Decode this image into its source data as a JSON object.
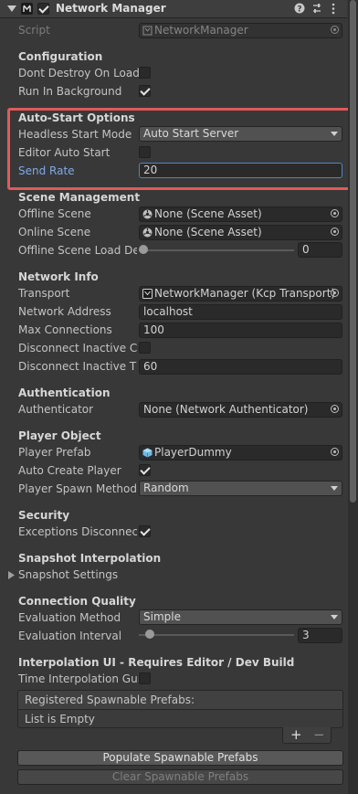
{
  "header": {
    "title": "Network Manager"
  },
  "script": {
    "label": "Script",
    "value": "NetworkManager"
  },
  "configuration": {
    "title": "Configuration",
    "dont_destroy": {
      "label": "Dont Destroy On Load",
      "checked": false
    },
    "run_background": {
      "label": "Run In Background",
      "checked": true
    }
  },
  "auto_start": {
    "title": "Auto-Start Options",
    "headless_mode": {
      "label": "Headless Start Mode",
      "value": "Auto Start Server"
    },
    "editor_auto_start": {
      "label": "Editor Auto Start",
      "checked": false
    },
    "send_rate": {
      "label": "Send Rate",
      "value": "20"
    }
  },
  "scene_management": {
    "title": "Scene Management",
    "offline_scene": {
      "label": "Offline Scene",
      "value": "None (Scene Asset)"
    },
    "online_scene": {
      "label": "Online Scene",
      "value": "None (Scene Asset)"
    },
    "offline_delay": {
      "label": "Offline Scene Load Del",
      "value": "0",
      "level": 0
    }
  },
  "network_info": {
    "title": "Network Info",
    "transport": {
      "label": "Transport",
      "value": "NetworkManager (Kcp Transport)"
    },
    "address": {
      "label": "Network Address",
      "value": "localhost"
    },
    "max_connections": {
      "label": "Max Connections",
      "value": "100"
    },
    "disconnect_inactive": {
      "label": "Disconnect Inactive Co",
      "checked": false
    },
    "disconnect_timeout": {
      "label": "Disconnect Inactive Tir",
      "value": "60"
    }
  },
  "authentication": {
    "title": "Authentication",
    "authenticator": {
      "label": "Authenticator",
      "value": "None (Network Authenticator)"
    }
  },
  "player_object": {
    "title": "Player Object",
    "prefab": {
      "label": "Player Prefab",
      "value": "PlayerDummy"
    },
    "auto_create": {
      "label": "Auto Create Player",
      "checked": true
    },
    "spawn_method": {
      "label": "Player Spawn Method",
      "value": "Random"
    }
  },
  "security": {
    "title": "Security",
    "exceptions": {
      "label": "Exceptions Disconnect",
      "checked": true
    }
  },
  "snapshot": {
    "title": "Snapshot Interpolation",
    "settings": {
      "label": "Snapshot Settings"
    }
  },
  "connection_quality": {
    "title": "Connection Quality",
    "method": {
      "label": "Evaluation Method",
      "value": "Simple"
    },
    "interval": {
      "label": "Evaluation Interval",
      "value": "3"
    }
  },
  "interp_ui": {
    "title": "Interpolation UI - Requires Editor / Dev Build",
    "time_gui": {
      "label": "Time Interpolation Gui",
      "checked": false
    }
  },
  "spawnables": {
    "header": "Registered Spawnable Prefabs:",
    "empty": "List is Empty",
    "add": "+",
    "remove": "−"
  },
  "buttons": {
    "populate": "Populate Spawnable Prefabs",
    "clear": "Clear Spawnable Prefabs"
  },
  "colors": {
    "highlight": "#e15a5a",
    "active_label": "#7fa9e8",
    "background": "#383838"
  }
}
